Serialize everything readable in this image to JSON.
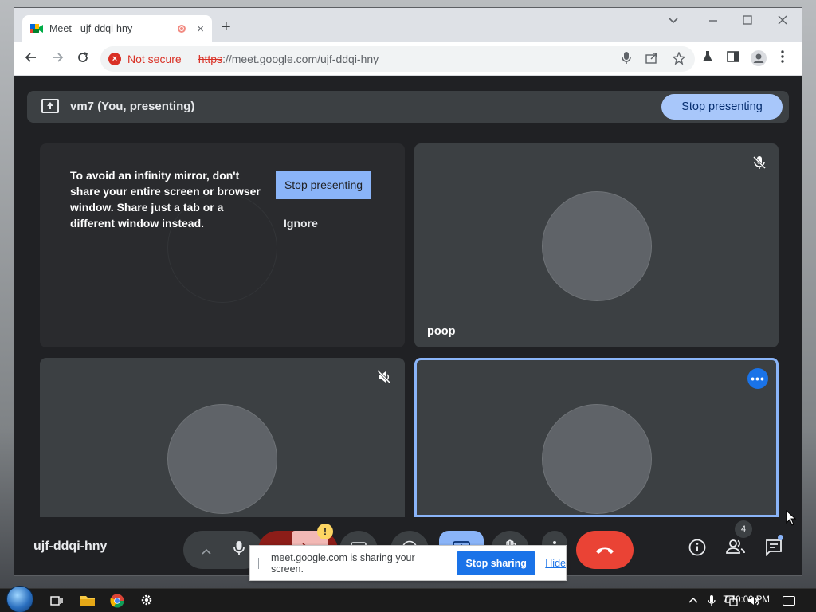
{
  "browser": {
    "tab_title": "Meet - ujf-ddqi-hny",
    "new_tab_symbol": "+",
    "close_symbol": "×",
    "security_label": "Not secure",
    "url_scheme": "https",
    "url_rest": "://meet.google.com/ujf-ddqi-hny"
  },
  "meet": {
    "presenting_label": "vm7 (You, presenting)",
    "stop_presenting_label": "Stop presenting",
    "mirror_warning": "To avoid an infinity mirror, don't share your entire screen or browser window. Share just a tab or a different window instead.",
    "mirror_stop_label": "Stop presenting",
    "mirror_ignore_label": "Ignore",
    "participants": [
      {
        "name": ""
      },
      {
        "name": "poop"
      },
      {
        "name": ""
      },
      {
        "name": ""
      }
    ],
    "more_options_symbol": "•••",
    "meeting_code": "ujf-ddqi-hny",
    "people_count": "4",
    "warning_symbol": "!"
  },
  "share_bar": {
    "text": "meet.google.com is sharing your screen.",
    "stop_label": "Stop sharing",
    "hide_label": "Hide"
  },
  "taskbar": {
    "clock": "7:10:00 PM"
  },
  "colors": {
    "stop_presenting_bg": "#a8c7fa",
    "end_call": "#ea4335",
    "present_active": "#8ab4f8",
    "stop_sharing_bg": "#1a73e8",
    "not_secure": "#d93025"
  }
}
